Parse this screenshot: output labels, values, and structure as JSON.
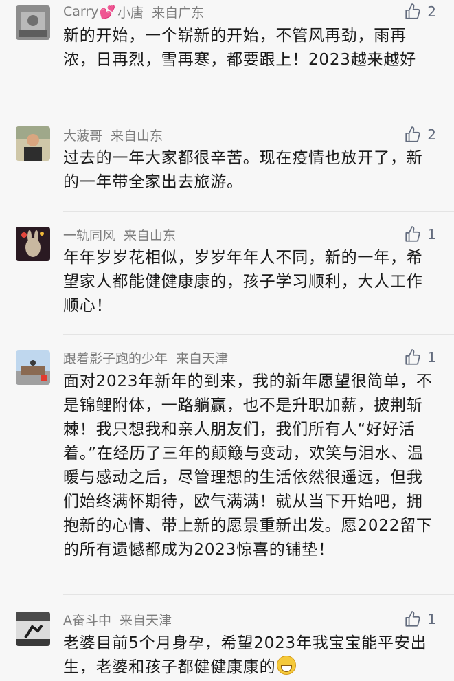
{
  "comments": [
    {
      "name": "Carry",
      "name_suffix": "小唐",
      "location": "来自广东",
      "likes": "2",
      "text": "新的开始，一个崭新的开始，不管风再劲，雨再浓，日再烈，雪再寒，都要跟上！2023越来越好"
    },
    {
      "name": "大菠哥",
      "location": "来自山东",
      "likes": "2",
      "text": "过去的一年大家都很辛苦。现在疫情也放开了，新的一年带全家出去旅游。"
    },
    {
      "name": "一轨同风",
      "location": "来自山东",
      "likes": "1",
      "text": "年年岁岁花相似，岁岁年年人不同，新的一年，希望家人都能健健康康的，孩子学习顺利，大人工作顺心！"
    },
    {
      "name": "跟着影子跑的少年",
      "location": "来自天津",
      "likes": "1",
      "text": "面对2023年新年的到来，我的新年愿望很简单，不是锦鲤附体，一路躺赢，也不是升职加薪，披荆斩棘！我只想我和亲人朋友们，我们所有人“好好活着。”在经历了三年的颠簸与变动，欢笑与泪水、温暖与感动之后，尽管理想的生活依然很遥远，但我们始终满怀期待，欧气满满！就从当下开始吧，拥抱新的心情、带上新的愿景重新出发。愿2022留下的所有遗憾都成为2023惊喜的铺垫！"
    },
    {
      "name": "A奋斗中",
      "location": "来自天津",
      "likes": "1",
      "text": "老婆目前5个月身孕，希望2023年我宝宝能平安出生，老婆和孩子都健健康康的"
    }
  ]
}
